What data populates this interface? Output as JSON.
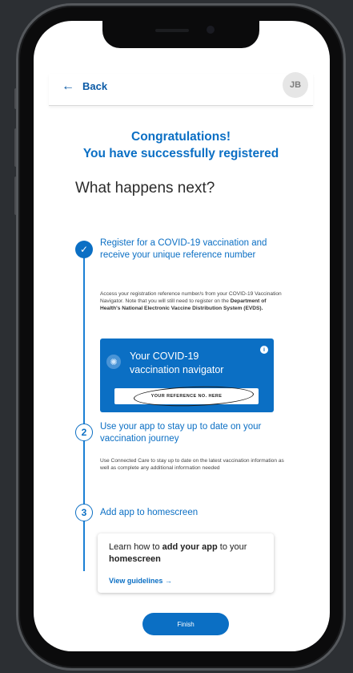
{
  "header": {
    "back_label": "Back",
    "avatar_initials": "JB"
  },
  "congrats": {
    "line1": "Congratulations!",
    "line2": "You have successfully registered"
  },
  "next_title": "What happens next?",
  "steps": [
    {
      "marker": "✓",
      "title": "Register for a COVID-19 vaccination and receive your unique reference number",
      "body_plain1": "Access your registration reference number/s from your COVID-19 Vaccination Navigator. Note that you will still need to register on the ",
      "body_bold": "Department of Health's National Electronic Vaccine Distribution System (EVDS).",
      "body_plain2": ""
    },
    {
      "marker": "2",
      "title": "Use your app to stay up to date on your vaccination journey",
      "body": "Use Connected Care to stay up to date on the latest vaccination information as well as complete any additional information needed"
    },
    {
      "marker": "3",
      "title": "Add app to homescreen"
    }
  ],
  "navigator_card": {
    "title": "Your COVID-19 vaccination navigator",
    "info_glyph": "i",
    "virus_glyph": "✺",
    "reference_placeholder": "YOUR REFERENCE NO. HERE"
  },
  "learn_card": {
    "text_pre": "Learn how to ",
    "text_bold1": "add your app",
    "text_mid": " to your ",
    "text_bold2": "homescreen",
    "link_label": "View guidelines",
    "link_arrow": "→"
  },
  "finish_label": "Finish",
  "colors": {
    "primary": "#0b6fc4",
    "background": "#2c2f33"
  }
}
